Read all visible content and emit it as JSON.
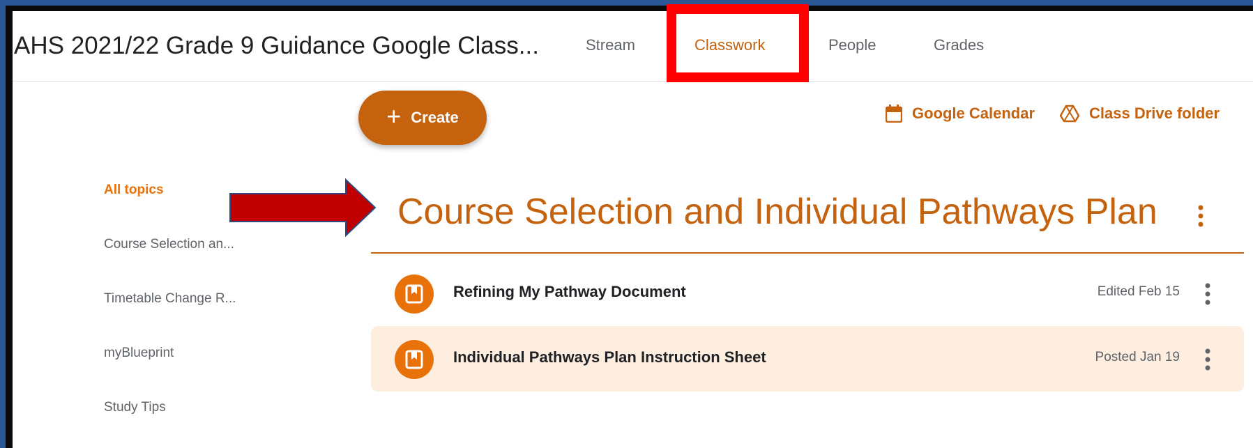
{
  "header": {
    "class_title": "AHS 2021/22 Grade 9 Guidance Google Class...",
    "tabs": [
      {
        "label": "Stream",
        "active": false
      },
      {
        "label": "Classwork",
        "active": true
      },
      {
        "label": "People",
        "active": false
      },
      {
        "label": "Grades",
        "active": false
      }
    ]
  },
  "toolbar": {
    "create_label": "Create",
    "calendar_label": "Google Calendar",
    "drive_label": "Class Drive folder"
  },
  "topics": [
    {
      "label": "All topics",
      "active": true
    },
    {
      "label": "Course Selection an...",
      "active": false
    },
    {
      "label": "Timetable Change R...",
      "active": false
    },
    {
      "label": "myBlueprint",
      "active": false
    },
    {
      "label": "Study Tips",
      "active": false
    }
  ],
  "section": {
    "title": "Course Selection and Individual Pathways Plan",
    "items": [
      {
        "title": "Refining My Pathway Document",
        "date": "Edited Feb 15",
        "icon": "material-icon"
      },
      {
        "title": "Individual Pathways Plan Instruction Sheet",
        "date": "Posted Jan 19",
        "icon": "material-icon"
      }
    ]
  },
  "colors": {
    "accent": "#c4620e",
    "accent_light": "#e8710a",
    "selected_row": "#fdeee0",
    "annotation_box": "#ff0000",
    "annotation_arrow": "#c00000",
    "frame": "#2b5797"
  },
  "annotations": {
    "highlight_icon": "red-rectangle",
    "arrow_icon": "red-arrow-right"
  }
}
